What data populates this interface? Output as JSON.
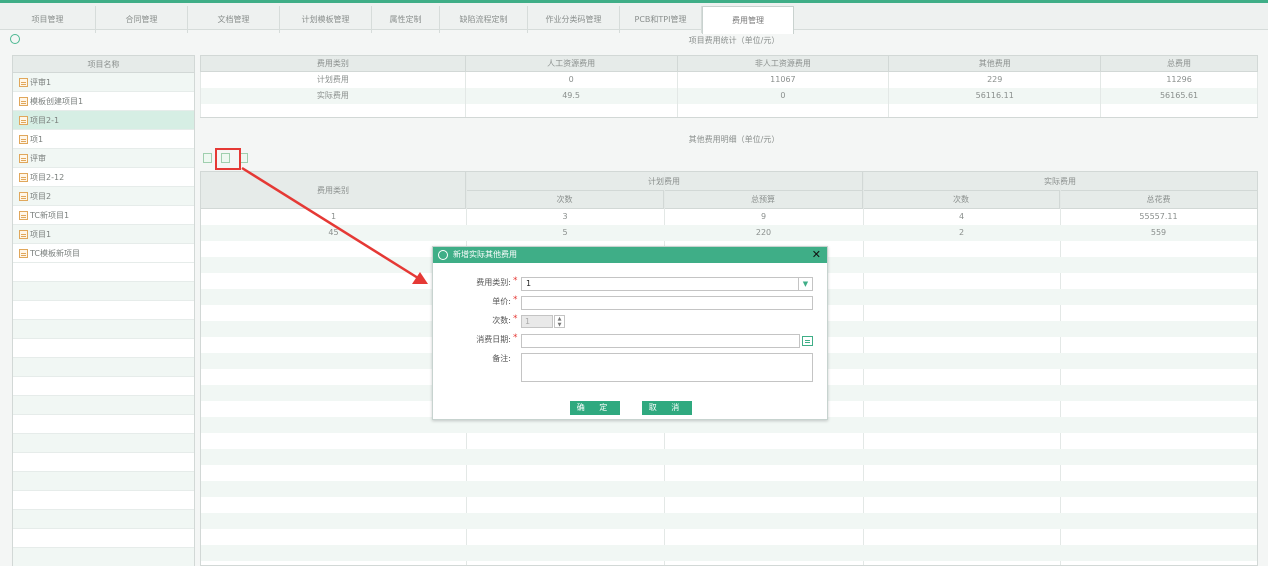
{
  "tabs": [
    "项目管理",
    "合同管理",
    "文档管理",
    "计划模板管理",
    "属性定制",
    "缺陷流程定制",
    "作业分类码管理",
    "PCB和TPI管理",
    "费用管理"
  ],
  "active_tab": "费用管理",
  "left_panel": {
    "header": "项目名称",
    "items": [
      "评审1",
      "模板创建项目1",
      "项目2-1",
      "项1",
      "评审",
      "项目2-12",
      "项目2",
      "TC新项目1",
      "项目1",
      "TC模板新项目"
    ],
    "selected_index": 2
  },
  "stats": {
    "title": "项目费用统计（单位/元）",
    "headers": [
      "费用类别",
      "人工资源费用",
      "非人工资源费用",
      "其他费用",
      "总费用"
    ],
    "rows": [
      [
        "计划费用",
        "0",
        "11067",
        "229",
        "11296"
      ],
      [
        "实际费用",
        "49.5",
        "0",
        "56116.11",
        "56165.61"
      ]
    ]
  },
  "detail": {
    "title": "其他费用明细（单位/元）",
    "col_category": "费用类别",
    "group_plan": "计划费用",
    "group_actual": "实际费用",
    "sub_headers": [
      "次数",
      "总预算",
      "次数",
      "总花费"
    ],
    "rows": [
      [
        "1",
        "3",
        "9",
        "4",
        "55557.11"
      ],
      [
        "45",
        "5",
        "220",
        "2",
        "559"
      ]
    ]
  },
  "dialog": {
    "title": "新增实际其他费用",
    "close": "✕",
    "fields": {
      "category_label": "费用类别:",
      "category_value": "1",
      "price_label": "单价:",
      "count_label": "次数:",
      "count_value": "1",
      "date_label": "消费日期:",
      "note_label": "备注:"
    },
    "required_mark": "*",
    "confirm": "确 定",
    "cancel": "取 消"
  },
  "colors": {
    "accent": "#3fae87",
    "highlight": "#e53935"
  }
}
